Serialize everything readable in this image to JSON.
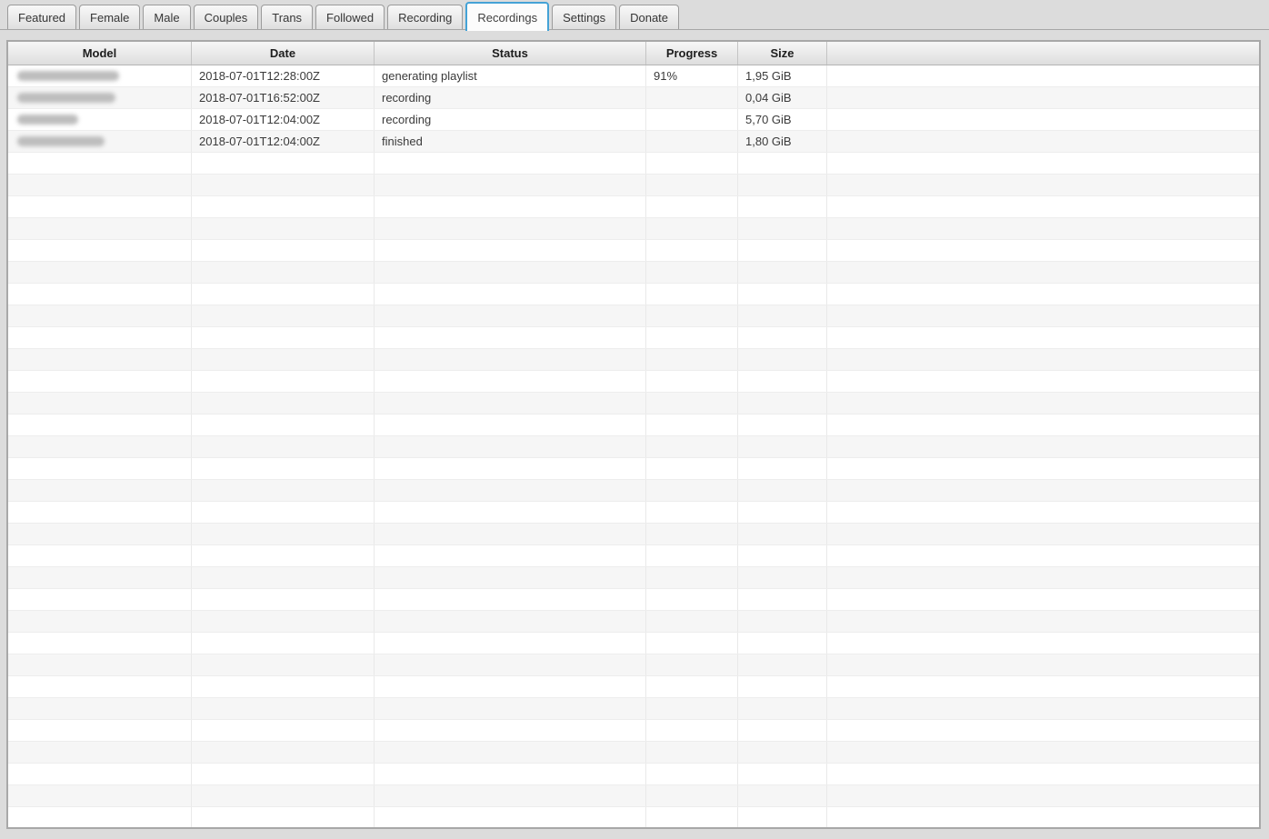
{
  "tabs": [
    {
      "label": "Featured",
      "selected": false
    },
    {
      "label": "Female",
      "selected": false
    },
    {
      "label": "Male",
      "selected": false
    },
    {
      "label": "Couples",
      "selected": false
    },
    {
      "label": "Trans",
      "selected": false
    },
    {
      "label": "Followed",
      "selected": false
    },
    {
      "label": "Recording",
      "selected": false
    },
    {
      "label": "Recordings",
      "selected": true
    },
    {
      "label": "Settings",
      "selected": false
    },
    {
      "label": "Donate",
      "selected": false
    }
  ],
  "accent_color": "#44a2d6",
  "table": {
    "columns": [
      "Model",
      "Date",
      "Status",
      "Progress",
      "Size",
      ""
    ],
    "rows": [
      {
        "model_censored": true,
        "censor_width": 112,
        "date": "2018-07-01T12:28:00Z",
        "status": "generating playlist",
        "progress": "91%",
        "size": "1,95 GiB"
      },
      {
        "model_censored": true,
        "censor_width": 108,
        "date": "2018-07-01T16:52:00Z",
        "status": "recording",
        "progress": "",
        "size": "0,04 GiB"
      },
      {
        "model_censored": true,
        "censor_width": 67,
        "date": "2018-07-01T12:04:00Z",
        "status": "recording",
        "progress": "",
        "size": "5,70 GiB"
      },
      {
        "model_censored": true,
        "censor_width": 96,
        "date": "2018-07-01T12:04:00Z",
        "status": "finished",
        "progress": "",
        "size": "1,80 GiB"
      }
    ],
    "empty_row_count": 31
  }
}
